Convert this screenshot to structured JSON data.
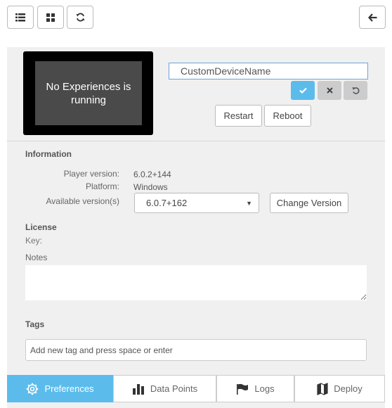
{
  "toolbar": {
    "list_icon": "list-icon",
    "grid_icon": "grid-icon",
    "refresh_icon": "refresh-icon",
    "back_icon": "arrow-left-icon"
  },
  "device": {
    "screen_text": "No Experiences is running",
    "name_value": "CustomDeviceName",
    "restart_label": "Restart",
    "reboot_label": "Reboot"
  },
  "information": {
    "heading": "Information",
    "player_version_label": "Player version:",
    "player_version_value": "6.0.2+144",
    "platform_label": "Platform:",
    "platform_value": "Windows",
    "available_label": "Available version(s)",
    "available_selected": "6.0.7+162",
    "change_version_label": "Change Version"
  },
  "license": {
    "heading": "License",
    "key_label": "Key:",
    "notes_label": "Notes"
  },
  "tags": {
    "heading": "Tags",
    "placeholder": "Add new tag and press space or enter"
  },
  "tabs": [
    {
      "label": "Preferences",
      "icon": "gear-icon",
      "active": true
    },
    {
      "label": "Data Points",
      "icon": "bar-chart-icon",
      "active": false
    },
    {
      "label": "Logs",
      "icon": "flag-icon",
      "active": false
    },
    {
      "label": "Deploy",
      "icon": "map-icon",
      "active": false
    }
  ],
  "colors": {
    "accent": "#5bbcec",
    "panel": "#f0f0f0"
  }
}
